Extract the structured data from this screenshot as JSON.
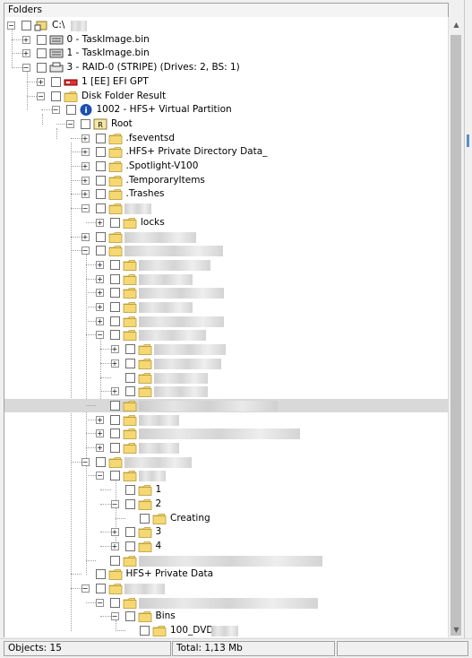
{
  "panel": {
    "title": "Folders"
  },
  "tree": {
    "rows": [
      {
        "label": "C:\\",
        "icon": "drive-icon"
      },
      {
        "label": "0 - TaskImage.bin",
        "icon": "disk-image-icon"
      },
      {
        "label": "1 - TaskImage.bin",
        "icon": "disk-image-icon"
      },
      {
        "label": "3 - RAID-0 (STRIPE) (Drives: 2, BS: 1)",
        "icon": "raid-icon"
      },
      {
        "label": "1 [EE] EFI GPT",
        "icon": "partition-icon"
      },
      {
        "label": "Disk Folder Result",
        "icon": "folder-icon"
      },
      {
        "label": "1002 - HFS+ Virtual Partition",
        "icon": "info-icon"
      },
      {
        "label": "Root",
        "icon": "root-folder-icon"
      },
      {
        "label": ".fseventsd",
        "icon": "folder-icon"
      },
      {
        "label": ".HFS+ Private Directory Data_",
        "icon": "folder-icon"
      },
      {
        "label": ".Spotlight-V100",
        "icon": "folder-icon"
      },
      {
        "label": ".TemporaryItems",
        "icon": "folder-icon"
      },
      {
        "label": ".Trashes",
        "icon": "folder-icon"
      },
      {
        "label": "",
        "icon": "folder-icon"
      },
      {
        "label": "locks",
        "icon": "folder-icon"
      },
      {
        "label": "1",
        "icon": "folder-icon"
      },
      {
        "label": "2",
        "icon": "folder-icon"
      },
      {
        "label": "Creating",
        "icon": "folder-icon"
      },
      {
        "label": "3",
        "icon": "folder-icon"
      },
      {
        "label": "4",
        "icon": "folder-icon"
      },
      {
        "label": "HFS+ Private Data",
        "icon": "folder-icon"
      },
      {
        "label": "Bins",
        "icon": "folder-icon"
      },
      {
        "label": "100_DVD",
        "icon": "folder-icon"
      }
    ]
  },
  "status": {
    "objects": "Objects: 15",
    "total": "Total: 1,13 Mb"
  },
  "colors": {
    "folder": "#f6d873",
    "folder_border": "#b89a3a",
    "selection": "#d9d9d9"
  }
}
